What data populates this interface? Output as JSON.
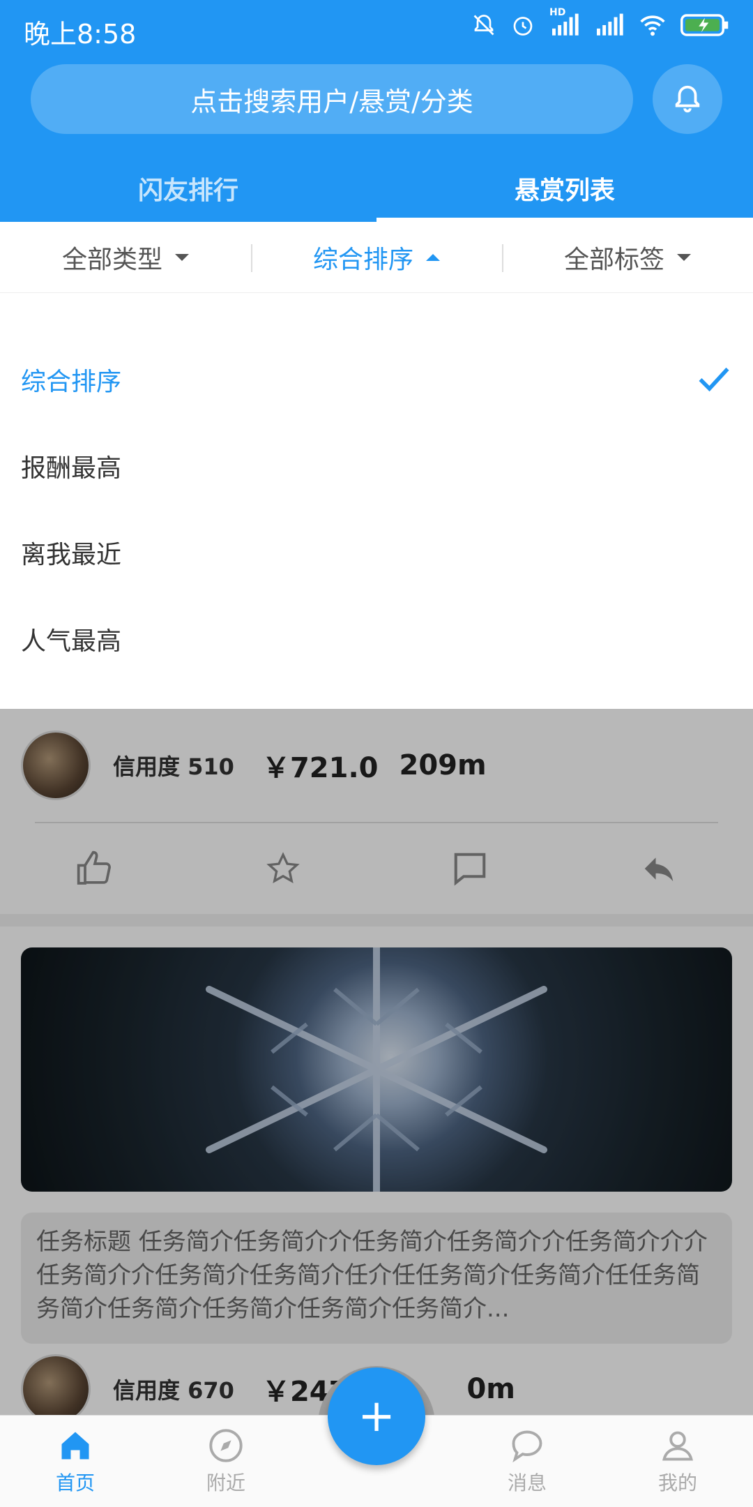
{
  "status_bar": {
    "time": "晚上8:58",
    "network_badge": "HD"
  },
  "header": {
    "search_placeholder": "点击搜索用户/悬赏/分类",
    "tabs": [
      {
        "label": "闪友排行",
        "active": false
      },
      {
        "label": "悬赏列表",
        "active": true
      }
    ]
  },
  "filters": [
    {
      "label": "全部类型",
      "active": false
    },
    {
      "label": "综合排序",
      "active": true
    },
    {
      "label": "全部标签",
      "active": false
    }
  ],
  "sort_options": [
    {
      "label": "综合排序",
      "selected": true
    },
    {
      "label": "报酬最高",
      "selected": false
    },
    {
      "label": "离我最近",
      "selected": false
    },
    {
      "label": "人气最高",
      "selected": false
    }
  ],
  "posts": [
    {
      "credit": "信用度 510",
      "price": "￥721.0",
      "distance": "209m"
    },
    {
      "credit": "信用度 670",
      "price": "￥247",
      "distance": "0m",
      "description": "任务标题  任务简介任务简介介任务简介任务简介介任务简介介介任务简介介任务简介任务简介任介任任务简介任务简介任任务简务简介任务简介任务简介任务简介任务简介..."
    }
  ],
  "fab": {
    "label": "+"
  },
  "bottom_nav": [
    {
      "label": "首页",
      "icon": "home-icon",
      "active": true
    },
    {
      "label": "附近",
      "icon": "compass-icon",
      "active": false
    },
    {
      "label": "消息",
      "icon": "chat-icon",
      "active": false
    },
    {
      "label": "我的",
      "icon": "person-icon",
      "active": false
    }
  ],
  "colors": {
    "accent": "#2196F3",
    "overlay": "rgba(0,0,0,0.28)"
  }
}
